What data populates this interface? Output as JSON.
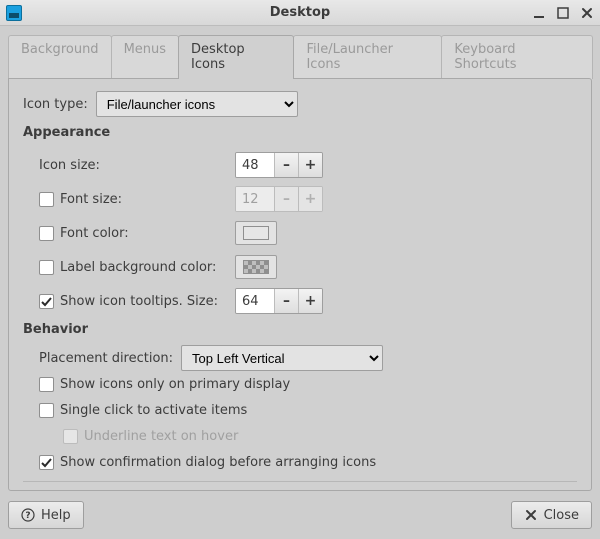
{
  "window": {
    "title": "Desktop"
  },
  "tabs": [
    {
      "label": "Background"
    },
    {
      "label": "Menus"
    },
    {
      "label": "Desktop Icons"
    },
    {
      "label": "File/Launcher Icons"
    },
    {
      "label": "Keyboard Shortcuts"
    }
  ],
  "active_tab_index": 2,
  "icon_type": {
    "label": "Icon type:",
    "value": "File/launcher icons"
  },
  "appearance": {
    "title": "Appearance",
    "icon_size": {
      "label": "Icon size:",
      "value": "48"
    },
    "font_size": {
      "label": "Font size:",
      "value": "12",
      "checked": false
    },
    "font_color": {
      "label": "Font color:",
      "checked": false
    },
    "label_bg": {
      "label": "Label background color:",
      "checked": false
    },
    "tooltips": {
      "label": "Show icon tooltips. Size:",
      "value": "64",
      "checked": true
    }
  },
  "behavior": {
    "title": "Behavior",
    "placement": {
      "label": "Placement direction:",
      "value": "Top Left Vertical"
    },
    "primary": {
      "label": "Show icons only on primary display",
      "checked": false
    },
    "single_click": {
      "label": "Single click to activate items",
      "checked": false
    },
    "underline": {
      "label": "Underline text on hover",
      "checked": false,
      "enabled": false
    },
    "confirm": {
      "label": "Show confirmation dialog before arranging icons",
      "checked": true
    }
  },
  "buttons": {
    "help": "Help",
    "close": "Close"
  },
  "spinner": {
    "minus": "–",
    "plus": "+"
  }
}
